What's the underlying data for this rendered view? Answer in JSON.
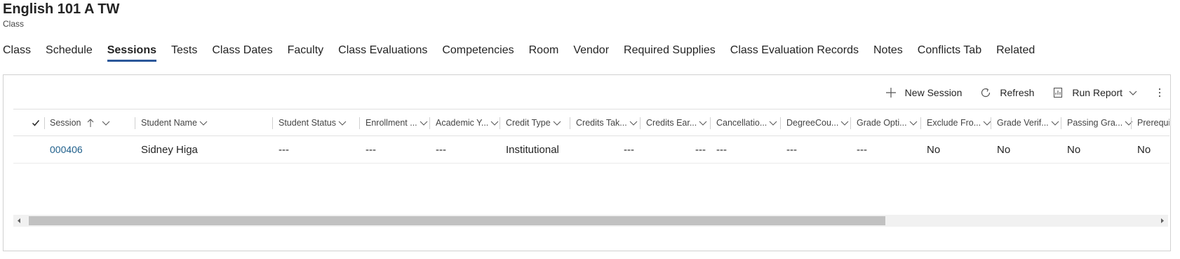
{
  "header": {
    "title": "English 101 A TW",
    "subtitle": "Class"
  },
  "tabs": [
    {
      "label": "Class"
    },
    {
      "label": "Schedule"
    },
    {
      "label": "Sessions"
    },
    {
      "label": "Tests"
    },
    {
      "label": "Class Dates"
    },
    {
      "label": "Faculty"
    },
    {
      "label": "Class Evaluations"
    },
    {
      "label": "Competencies"
    },
    {
      "label": "Room"
    },
    {
      "label": "Vendor"
    },
    {
      "label": "Required Supplies"
    },
    {
      "label": "Class Evaluation Records"
    },
    {
      "label": "Notes"
    },
    {
      "label": "Conflicts Tab"
    },
    {
      "label": "Related"
    }
  ],
  "active_tab": "Sessions",
  "toolbar": {
    "new_label": "New Session",
    "refresh_label": "Refresh",
    "report_label": "Run Report"
  },
  "columns": [
    "Session",
    "Student Name",
    "Student Status",
    "Enrollment ...",
    "Academic Y...",
    "Credit Type",
    "Credits Tak...",
    "Credits Ear...",
    "Cancellatio...",
    "DegreeCou...",
    "Grade Opti...",
    "Exclude Fro...",
    "Grade Verif...",
    "Passing Gra...",
    "Prerequi"
  ],
  "row": {
    "session": "000406",
    "student_name": "Sidney Higa",
    "student_status": "---",
    "enrollment": "---",
    "academic_year": "---",
    "credit_type": "Institutional",
    "credits_taken": "---",
    "credits_earned": "---",
    "cancellation": "---",
    "degree_count": "---",
    "grade_option": "---",
    "exclude_from": "No",
    "grade_verified": "No",
    "passing_grade": "No",
    "prerequisite": "No"
  }
}
